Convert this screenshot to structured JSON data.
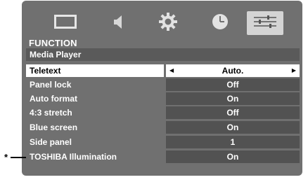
{
  "tabs": [
    {
      "icon": "picture-icon"
    },
    {
      "icon": "speaker-icon"
    },
    {
      "icon": "gear-icon"
    },
    {
      "icon": "clock-icon"
    },
    {
      "icon": "sliders-icon",
      "active": true
    }
  ],
  "section_title": "FUNCTION",
  "header_item": "Media Player",
  "items": [
    {
      "label": "Teletext",
      "value": "Auto.",
      "selected": true
    },
    {
      "label": "Panel lock",
      "value": "Off"
    },
    {
      "label": "Auto format",
      "value": "On"
    },
    {
      "label": "4:3 stretch",
      "value": "Off"
    },
    {
      "label": "Blue screen",
      "value": "On"
    },
    {
      "label": "Side panel",
      "value": "1"
    },
    {
      "label": "TOSHIBA Illumination",
      "value": "On"
    }
  ],
  "annotation_marker": "*",
  "colors": {
    "panel": "#707070",
    "value_bg": "#525252",
    "selected_bg": "#ffffff",
    "active_tab": "#d4d4d4"
  }
}
